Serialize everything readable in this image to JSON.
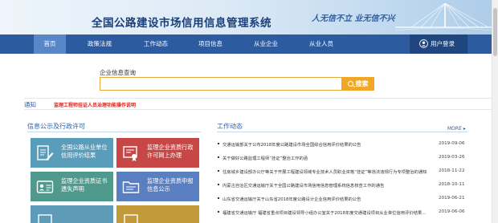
{
  "header": {
    "site_title": "全国公路建设市场信用信息管理系统",
    "slogan": "人无信不立 业无信不兴"
  },
  "nav": {
    "items": [
      "首页",
      "政策法规",
      "工作动态",
      "项目信息",
      "从业企业",
      "从业人员"
    ],
    "active_index": 0,
    "login_label": "用户登录"
  },
  "search": {
    "label": "企业信息查询",
    "value": "",
    "button_label": "搜索"
  },
  "notice": {
    "tag": "通知",
    "text": "监理工程师挂证人员治理功能操作说明"
  },
  "left_section": {
    "title": "信息公示及行政许可",
    "tiles": [
      {
        "label": "全国公路从业单位信用评价结果",
        "color": "#5a9dba",
        "icon": "document-pen-icon"
      },
      {
        "label": "监理企业资质行政许可网上办理",
        "color": "#c74747",
        "icon": "certificate-icon"
      },
      {
        "label": "监理企业资质证书遗失声明",
        "color": "#4f9a8d",
        "icon": "id-card-icon"
      },
      {
        "label": "监理企业资质申报信息公示",
        "color": "#5a7fc0",
        "icon": "folder-icon"
      },
      {
        "label": "",
        "color": "#5d9bb8",
        "icon": "tile-icon"
      },
      {
        "label": "",
        "color": "#c29a3a",
        "icon": "tile-icon"
      }
    ]
  },
  "right_section": {
    "title": "工作动态",
    "more_label": "MORE ▸",
    "news": [
      {
        "title": "交通运输部关于公布2018年度公路建设市场全国综合信用评价结果的公告",
        "date": "2019-09-06"
      },
      {
        "title": "关于做好公路监理工程师“挂证”整治工作的函",
        "date": "2019-03-26"
      },
      {
        "title": "住房城乡建设部办公厅等关于开展工程建设领域专业技术人员职业资格“挂证”等违法违规行为专项整治的通知",
        "date": "2018-11-22"
      },
      {
        "title": "内蒙古自治区交通运输厅关于全国公路建设市场信用信息管理系统信息核查工作的通告",
        "date": "2018-10-11"
      },
      {
        "title": "山东省交通运输厅关于山东省2018年度公路设计企业信用评价结果的公告",
        "date": "2019-06-21"
      },
      {
        "title": "福建省交通运输厅 福建省重点项目建设领导小组办公室关于2018年度交通建设项目从业单位信用评价结果的通报",
        "date": "2019-06-06"
      }
    ]
  },
  "colors": {
    "nav_bg": "#2c5ba0",
    "nav_active": "#5886c7",
    "accent_orange": "#f0a727",
    "notice_red": "#d7261e",
    "link_blue": "#2b5fa8"
  }
}
